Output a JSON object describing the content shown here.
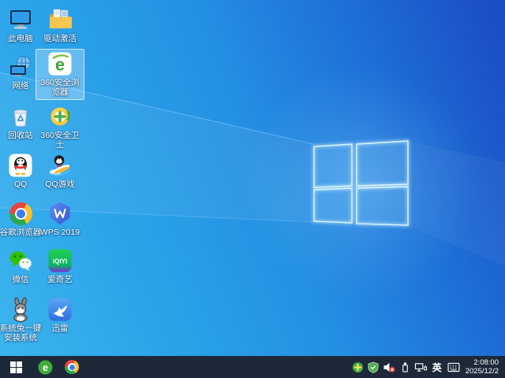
{
  "wallpaper": {
    "style": "windows10-light-rays-logo",
    "colors": {
      "bottom_left": "#3cb4ee",
      "top_right": "#194dc2",
      "logo_edge": "#c9efff"
    }
  },
  "desktop": {
    "icons": [
      {
        "label": "此电脑",
        "name": "this-pc",
        "selected": false
      },
      {
        "label": "驱动激活",
        "name": "driver-activation-folder",
        "selected": false
      },
      {
        "label": "网络",
        "name": "network",
        "selected": false
      },
      {
        "label": "360安全浏览器",
        "name": "360-safe-browser",
        "selected": true,
        "icon_text": "e"
      },
      {
        "label": "回收站",
        "name": "recycle-bin",
        "selected": false
      },
      {
        "label": "360安全卫士",
        "name": "360-safe-guard",
        "selected": false
      },
      {
        "label": "QQ",
        "name": "qq",
        "selected": false
      },
      {
        "label": "QQ游戏",
        "name": "qq-games",
        "selected": false
      },
      {
        "label": "谷歌浏览器",
        "name": "google-chrome",
        "selected": false
      },
      {
        "label": "WPS 2019",
        "name": "wps-2019",
        "selected": false
      },
      {
        "label": "微信",
        "name": "wechat",
        "selected": false
      },
      {
        "label": "爱奇艺",
        "name": "iqiyi",
        "selected": false,
        "icon_text": "iQIYI"
      },
      {
        "label": "系统兔一键安装系统",
        "name": "xitongtu-onekey-install",
        "selected": false
      },
      {
        "label": "迅雷",
        "name": "xunlei-thunder",
        "selected": false
      }
    ]
  },
  "taskbar": {
    "background": "#1d2939",
    "pinned": [
      {
        "name": "start-button"
      },
      {
        "name": "360-safe-browser",
        "icon_text": "e"
      },
      {
        "name": "google-chrome"
      }
    ],
    "tray": {
      "icons": [
        "360-safe-tray",
        "defender-shield",
        "volume-muted",
        "usb-device",
        "wired-network"
      ],
      "ime_label": "英",
      "time": "2:08:00",
      "date": "2025/12/2"
    }
  }
}
